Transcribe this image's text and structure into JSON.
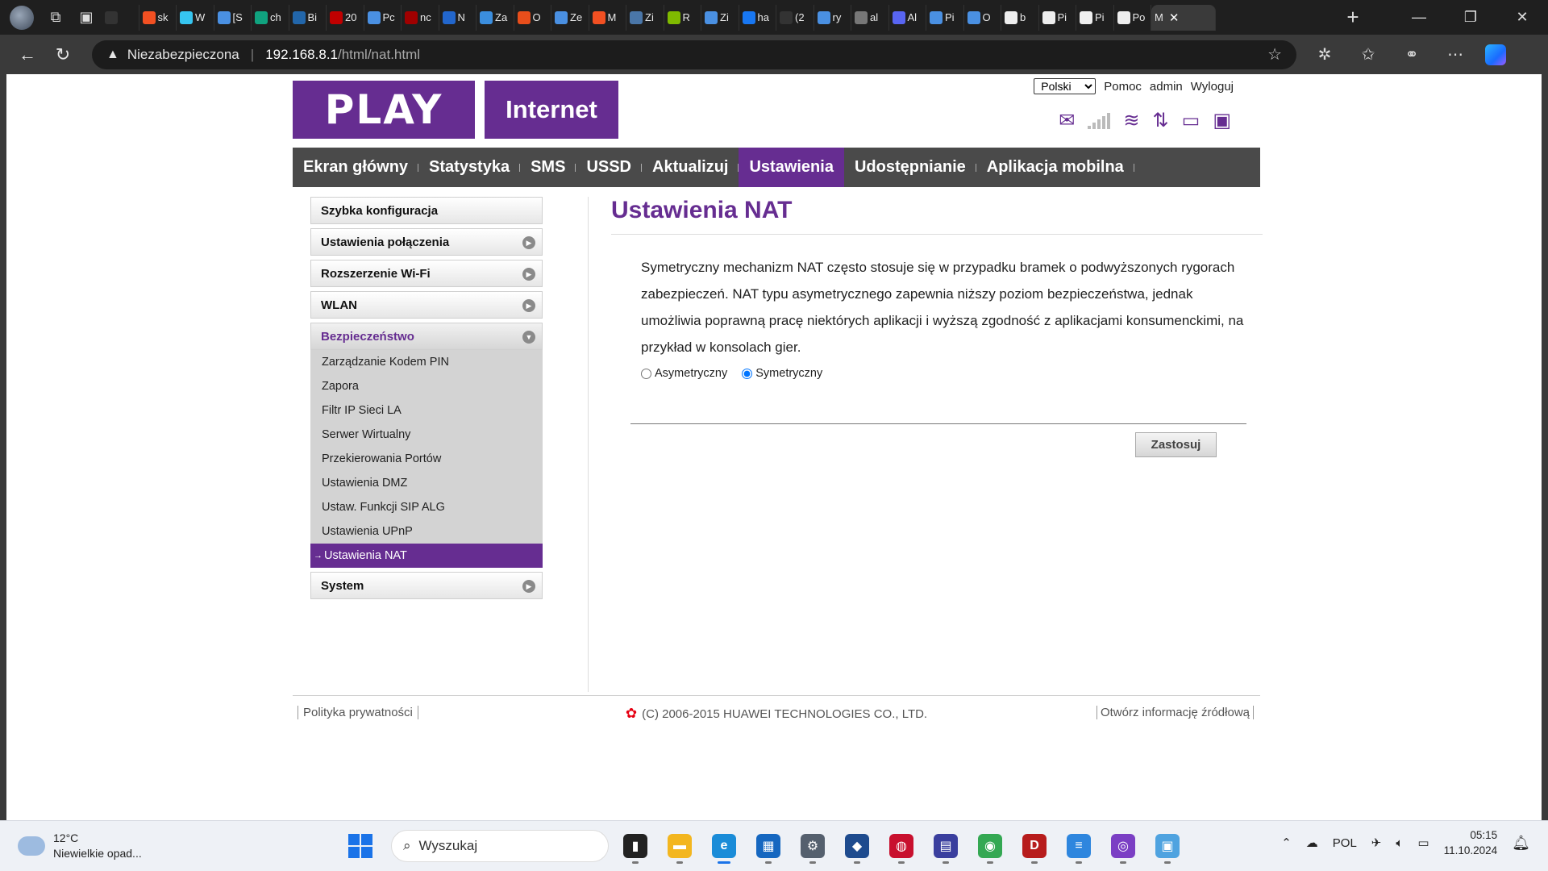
{
  "browser": {
    "tabs": [
      {
        "label": "",
        "icon": "github-icon",
        "color": "#333333"
      },
      {
        "label": "sk",
        "icon": "microsoft-icon",
        "color": "#f25022"
      },
      {
        "label": "W",
        "icon": "slack-icon",
        "color": "#36c5f0"
      },
      {
        "label": "[S",
        "icon": "search-icon",
        "color": "#4a90e2"
      },
      {
        "label": "ch",
        "icon": "openai-icon",
        "color": "#10a37f"
      },
      {
        "label": "Bi",
        "icon": "xm-icon",
        "color": "#2266aa"
      },
      {
        "label": "20",
        "icon": "eagle-icon",
        "color": "#c00000"
      },
      {
        "label": "Pc",
        "icon": "search-icon",
        "color": "#4a90e2"
      },
      {
        "label": "nc",
        "icon": "gov-icon",
        "color": "#a00000"
      },
      {
        "label": "N",
        "icon": "pen-icon",
        "color": "#2266cc"
      },
      {
        "label": "Za",
        "icon": "cloud-icon",
        "color": "#3b8ede"
      },
      {
        "label": "O",
        "icon": "pinwheel-icon",
        "color": "#e84e1b"
      },
      {
        "label": "Ze",
        "icon": "search-icon",
        "color": "#4a90e2"
      },
      {
        "label": "M",
        "icon": "microsoft-icon",
        "color": "#f25022"
      },
      {
        "label": "Zi",
        "icon": "vk-icon",
        "color": "#4a76a8"
      },
      {
        "label": "R",
        "icon": "microsoft-icon",
        "color": "#7fba00"
      },
      {
        "label": "Zi",
        "icon": "search-icon",
        "color": "#4a90e2"
      },
      {
        "label": "ha",
        "icon": "facebook-icon",
        "color": "#1877f2"
      },
      {
        "label": "(2",
        "icon": "github-icon",
        "color": "#333333"
      },
      {
        "label": "ry",
        "icon": "search-icon",
        "color": "#4a90e2"
      },
      {
        "label": "al",
        "icon": "speaker-icon",
        "color": "#777777"
      },
      {
        "label": "Al",
        "icon": "discord-icon",
        "color": "#5865f2"
      },
      {
        "label": "Pi",
        "icon": "search-icon",
        "color": "#4a90e2"
      },
      {
        "label": "O",
        "icon": "search-icon",
        "color": "#4a90e2"
      },
      {
        "label": "b",
        "icon": "quill-icon",
        "color": "#eeeeee"
      },
      {
        "label": "Pi",
        "icon": "quill-icon",
        "color": "#eeeeee"
      },
      {
        "label": "Pi",
        "icon": "quill-icon",
        "color": "#eeeeee"
      },
      {
        "label": "Po",
        "icon": "quill-icon",
        "color": "#eeeeee"
      }
    ],
    "active_tab": {
      "label": "M",
      "close": "✕"
    },
    "new_tab": "+",
    "security_label": "Niezabezpieczona",
    "url_host": "192.168.8.1",
    "url_path": "/html/nat.html"
  },
  "header": {
    "logo_main": "PLAY",
    "logo_sub": "Internet",
    "language": "Polski",
    "language_options": [
      "Polski"
    ],
    "help": "Pomoc",
    "user": "admin",
    "logout": "Wyloguj"
  },
  "nav": [
    {
      "label": "Ekran główny",
      "active": false
    },
    {
      "label": "Statystyka",
      "active": false
    },
    {
      "label": "SMS",
      "active": false
    },
    {
      "label": "USSD",
      "active": false
    },
    {
      "label": "Aktualizuj",
      "active": false
    },
    {
      "label": "Ustawienia",
      "active": true
    },
    {
      "label": "Udostępnianie",
      "active": false
    },
    {
      "label": "Aplikacja mobilna",
      "active": false
    }
  ],
  "sidebar": {
    "quick_config": "Szybka konfiguracja",
    "connection": "Ustawienia połączenia",
    "wifi_ext": "Rozszerzenie Wi-Fi",
    "wlan": "WLAN",
    "security": "Bezpieczeństwo",
    "security_items": [
      "Zarządzanie Kodem PIN",
      "Zapora",
      "Filtr IP Sieci LA",
      "Serwer Wirtualny",
      "Przekierowania Portów",
      "Ustawienia DMZ",
      "Ustaw. Funkcji SIP ALG",
      "Ustawienia UPnP"
    ],
    "active_item": "Ustawienia NAT",
    "active_marker": "→",
    "system": "System"
  },
  "content": {
    "title": "Ustawienia NAT",
    "description": "Symetryczny mechanizm NAT często stosuje się w przypadku bramek o podwyższonych rygorach zabezpieczeń. NAT typu asymetrycznego zapewnia niższy poziom bezpieczeństwa, jednak umożliwia poprawną pracę niektórych aplikacji i wyższą zgodność z aplikacjami konsumenckimi, na przykład w konsolach gier.",
    "option_asym": "Asymetryczny",
    "option_sym": "Symetryczny",
    "selected": "Symetryczny",
    "apply": "Zastosuj"
  },
  "footer": {
    "privacy": "Polityka prywatności",
    "copyright": "(C) 2006-2015 HUAWEI TECHNOLOGIES CO., LTD.",
    "opensource": "Otwórz informację źródłową"
  },
  "taskbar": {
    "temperature": "12°C",
    "weather": "Niewielkie opad...",
    "search_placeholder": "Wyszukaj",
    "apps": [
      {
        "icon": "terminal-icon",
        "color": "#222222",
        "active": false
      },
      {
        "icon": "file-explorer-icon",
        "color": "#f3b61f",
        "active": false
      },
      {
        "icon": "edge-icon",
        "color": "#1a8cd8",
        "active": true
      },
      {
        "icon": "store-icon",
        "color": "#1567c0",
        "active": false
      },
      {
        "icon": "settings-icon",
        "color": "#55606e",
        "active": false
      },
      {
        "icon": "virtualbox-icon",
        "color": "#1e4b8e",
        "active": false
      },
      {
        "icon": "paint-icon",
        "color": "#c8102e",
        "active": false
      },
      {
        "icon": "save-icon",
        "color": "#3a3f9e",
        "active": false
      },
      {
        "icon": "chrome-icon",
        "color": "#34a853",
        "active": false
      },
      {
        "icon": "d-app-icon",
        "color": "#b71c1c",
        "active": false
      },
      {
        "icon": "notepad-icon",
        "color": "#2e86de",
        "active": false
      },
      {
        "icon": "github-desktop-icon",
        "color": "#7b3fc4",
        "active": false
      },
      {
        "icon": "remote-desktop-icon",
        "color": "#4fa3e0",
        "active": false
      }
    ],
    "language": "POL",
    "time": "05:15",
    "date": "11.10.2024"
  }
}
